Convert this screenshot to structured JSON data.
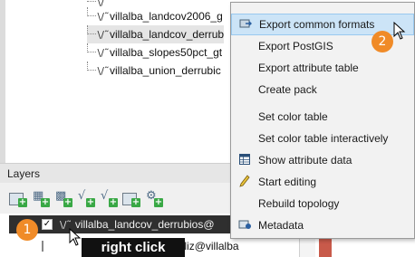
{
  "catalog": {
    "rows": [
      {
        "label": "villalba_landcov2006_g",
        "selected": false
      },
      {
        "label": "villalba_landcov_derrub",
        "selected": true
      },
      {
        "label": "villalba_slopes50pct_gt",
        "selected": false
      },
      {
        "label": "villalba_union_derrubic",
        "selected": false
      }
    ],
    "vector_glyph": "\\/˜"
  },
  "layers_panel": {
    "title": "Layers",
    "selected_layer": "villalba_landcov_derrubios@",
    "second_layer_partial": "generaliz@villalba",
    "checked_mark": "✓"
  },
  "annotations": {
    "step1": "1",
    "step2": "2",
    "right_click_label": "right click"
  },
  "context_menu": {
    "items": [
      {
        "label": "Export common formats",
        "icon": "export-icon",
        "highlighted": true
      },
      {
        "label": "Export PostGIS",
        "icon": "",
        "highlighted": false
      },
      {
        "label": "Export attribute table",
        "icon": "",
        "highlighted": false
      },
      {
        "label": "Create pack",
        "icon": "",
        "highlighted": false
      },
      {
        "label": "Set color table",
        "icon": "",
        "highlighted": false
      },
      {
        "label": "Set color table interactively",
        "icon": "",
        "highlighted": false
      },
      {
        "label": "Show attribute data",
        "icon": "table-icon",
        "highlighted": false
      },
      {
        "label": "Start editing",
        "icon": "pencil-icon",
        "highlighted": false
      },
      {
        "label": "Rebuild topology",
        "icon": "",
        "highlighted": false
      },
      {
        "label": "Metadata",
        "icon": "metadata-icon",
        "highlighted": false
      }
    ]
  },
  "colors": {
    "highlight": "#cce4f7",
    "badge": "#f08b28",
    "selected_layer_bg": "#2f2f2f"
  }
}
